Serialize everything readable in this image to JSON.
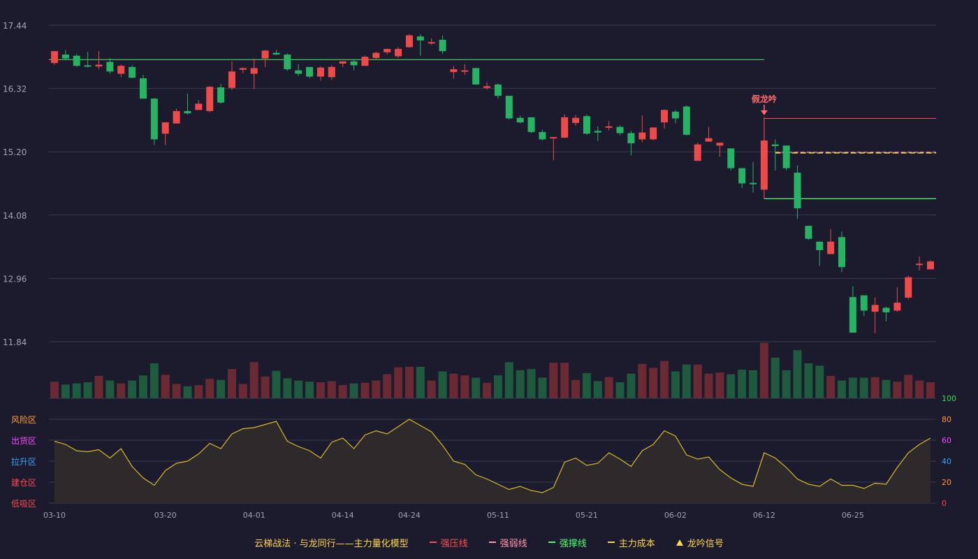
{
  "chart_data": {
    "type": "candlestick",
    "x_ticks": [
      "03-10",
      "03-20",
      "04-01",
      "04-14",
      "04-24",
      "05-11",
      "05-21",
      "06-02",
      "06-12",
      "06-25"
    ],
    "y_ticks": [
      "17.44",
      "16.32",
      "15.20",
      "14.08",
      "12.96",
      "11.84"
    ],
    "ylim": [
      11.84,
      17.44
    ],
    "candles": [
      [
        16.77,
        16.98,
        16.74,
        16.98
      ],
      [
        16.92,
        16.85,
        16.82,
        17.0
      ],
      [
        16.9,
        16.72,
        16.7,
        16.93
      ],
      [
        16.73,
        16.71,
        16.69,
        16.97
      ],
      [
        16.71,
        16.74,
        16.66,
        16.98
      ],
      [
        16.79,
        16.62,
        16.58,
        16.86
      ],
      [
        16.58,
        16.72,
        16.52,
        16.74
      ],
      [
        16.7,
        16.51,
        16.5,
        16.73
      ],
      [
        16.5,
        16.14,
        16.14,
        16.56
      ],
      [
        16.14,
        15.42,
        15.32,
        16.15
      ],
      [
        15.52,
        15.72,
        15.32,
        15.72
      ],
      [
        15.7,
        15.92,
        15.7,
        15.96
      ],
      [
        15.92,
        15.88,
        15.86,
        16.23
      ],
      [
        15.94,
        16.05,
        15.94,
        16.11
      ],
      [
        15.92,
        16.35,
        15.9,
        16.36
      ],
      [
        16.34,
        16.07,
        16.05,
        16.4
      ],
      [
        16.33,
        16.62,
        16.29,
        16.8
      ],
      [
        16.65,
        16.68,
        16.59,
        16.69
      ],
      [
        16.58,
        16.68,
        16.31,
        16.85
      ],
      [
        16.85,
        16.99,
        16.7,
        17.0
      ],
      [
        16.95,
        16.92,
        16.91,
        17.0
      ],
      [
        16.92,
        16.66,
        16.63,
        16.94
      ],
      [
        16.64,
        16.58,
        16.54,
        16.75
      ],
      [
        16.7,
        16.53,
        16.5,
        16.7
      ],
      [
        16.53,
        16.69,
        16.46,
        16.71
      ],
      [
        16.52,
        16.7,
        16.47,
        16.73
      ],
      [
        16.76,
        16.8,
        16.7,
        16.8
      ],
      [
        16.8,
        16.73,
        16.64,
        16.82
      ],
      [
        16.72,
        16.88,
        16.72,
        16.9
      ],
      [
        16.86,
        16.95,
        16.84,
        16.97
      ],
      [
        16.96,
        17.02,
        16.92,
        17.02
      ],
      [
        16.89,
        17.02,
        16.86,
        17.05
      ],
      [
        17.05,
        17.26,
        17.04,
        17.28
      ],
      [
        17.24,
        17.17,
        16.9,
        17.28
      ],
      [
        17.13,
        17.14,
        17.09,
        17.21
      ],
      [
        17.18,
        16.98,
        16.93,
        17.26
      ],
      [
        16.61,
        16.66,
        16.49,
        16.72
      ],
      [
        16.62,
        16.64,
        16.56,
        16.75
      ],
      [
        16.68,
        16.39,
        16.39,
        16.69
      ],
      [
        16.33,
        16.36,
        16.3,
        16.43
      ],
      [
        16.39,
        16.19,
        16.14,
        16.41
      ],
      [
        16.19,
        15.79,
        15.77,
        16.19
      ],
      [
        15.8,
        15.72,
        15.7,
        15.84
      ],
      [
        15.81,
        15.55,
        15.53,
        15.81
      ],
      [
        15.55,
        15.42,
        15.4,
        15.59
      ],
      [
        15.44,
        15.46,
        15.05,
        15.46
      ],
      [
        15.45,
        15.81,
        15.44,
        15.86
      ],
      [
        15.71,
        15.8,
        15.66,
        15.85
      ],
      [
        15.83,
        15.52,
        15.5,
        15.86
      ],
      [
        15.57,
        15.54,
        15.39,
        15.65
      ],
      [
        15.63,
        15.65,
        15.58,
        15.74
      ],
      [
        15.64,
        15.53,
        15.49,
        15.67
      ],
      [
        15.53,
        15.35,
        15.14,
        15.57
      ],
      [
        15.42,
        15.54,
        15.37,
        15.84
      ],
      [
        15.42,
        15.63,
        15.4,
        15.63
      ],
      [
        15.72,
        15.94,
        15.61,
        15.95
      ],
      [
        15.91,
        15.79,
        15.7,
        15.94
      ],
      [
        16.0,
        15.5,
        15.49,
        16.02
      ],
      [
        15.04,
        15.33,
        15.04,
        15.36
      ],
      [
        15.38,
        15.44,
        15.38,
        15.64
      ],
      [
        15.31,
        15.36,
        15.11,
        15.36
      ],
      [
        15.26,
        14.91,
        14.87,
        15.26
      ],
      [
        14.91,
        14.64,
        14.56,
        14.91
      ],
      [
        14.65,
        14.64,
        14.48,
        15.02
      ],
      [
        14.53,
        15.4,
        14.53,
        15.81
      ],
      [
        15.33,
        15.3,
        14.87,
        15.42
      ],
      [
        15.31,
        14.91,
        14.87,
        15.29
      ],
      [
        14.83,
        14.2,
        14.01,
        14.96
      ],
      [
        13.89,
        13.66,
        13.64,
        13.89
      ],
      [
        13.61,
        13.46,
        13.18,
        13.61
      ],
      [
        13.39,
        13.61,
        13.39,
        13.83
      ],
      [
        13.69,
        13.16,
        13.07,
        13.79
      ],
      [
        12.63,
        12.0,
        12.0,
        12.82
      ],
      [
        12.66,
        12.39,
        12.29,
        12.66
      ],
      [
        12.37,
        12.49,
        11.99,
        12.62
      ],
      [
        12.44,
        12.36,
        12.2,
        12.46
      ],
      [
        12.39,
        12.53,
        12.37,
        12.8
      ],
      [
        12.62,
        12.98,
        12.59,
        13.01
      ],
      [
        13.22,
        13.22,
        13.1,
        13.35
      ],
      [
        13.12,
        13.26,
        13.12,
        13.28
      ]
    ],
    "volumes": [
      0.29,
      0.24,
      0.26,
      0.28,
      0.39,
      0.31,
      0.26,
      0.31,
      0.4,
      0.61,
      0.41,
      0.25,
      0.21,
      0.23,
      0.34,
      0.32,
      0.51,
      0.25,
      0.63,
      0.38,
      0.48,
      0.35,
      0.31,
      0.29,
      0.28,
      0.3,
      0.23,
      0.26,
      0.27,
      0.31,
      0.42,
      0.54,
      0.55,
      0.55,
      0.31,
      0.47,
      0.43,
      0.4,
      0.36,
      0.27,
      0.4,
      0.63,
      0.49,
      0.51,
      0.36,
      0.62,
      0.62,
      0.32,
      0.44,
      0.3,
      0.37,
      0.28,
      0.43,
      0.6,
      0.53,
      0.65,
      0.47,
      0.59,
      0.59,
      0.43,
      0.45,
      0.42,
      0.5,
      0.49,
      0.97,
      0.71,
      0.49,
      0.84,
      0.61,
      0.57,
      0.39,
      0.31,
      0.36,
      0.36,
      0.37,
      0.32,
      0.29,
      0.41,
      0.31,
      0.28
    ],
    "oscillator": {
      "left_labels": [
        {
          "text": "风险区",
          "color": "#ff9f33"
        },
        {
          "text": "出货区",
          "color": "#ff44ff"
        },
        {
          "text": "拉升区",
          "color": "#3da5ff"
        },
        {
          "text": "建仓区",
          "color": "#ff4455"
        },
        {
          "text": "低吸区",
          "color": "#ff4455"
        }
      ],
      "right_ticks": [
        {
          "text": "100",
          "color": "#33dd55"
        },
        {
          "text": "80",
          "color": "#ff9f33"
        },
        {
          "text": "60",
          "color": "#ff44ff"
        },
        {
          "text": "40",
          "color": "#3da5ff"
        },
        {
          "text": "20",
          "color": "#ff9f33"
        },
        {
          "text": "0",
          "color": "#ff4455"
        }
      ],
      "values": [
        59,
        56,
        50,
        49,
        51,
        43,
        52,
        35,
        24,
        17,
        31,
        38,
        40,
        47,
        57,
        52,
        66,
        71,
        72,
        75,
        78,
        59,
        54,
        50,
        43,
        58,
        62,
        52,
        65,
        69,
        66,
        73,
        80,
        74,
        68,
        55,
        40,
        37,
        27,
        23,
        18,
        13,
        16,
        12,
        10,
        15,
        39,
        43,
        36,
        38,
        48,
        42,
        35,
        50,
        56,
        69,
        64,
        46,
        42,
        44,
        32,
        24,
        18,
        16,
        48,
        43,
        34,
        23,
        18,
        16,
        23,
        17,
        17,
        14,
        19,
        18,
        34,
        48,
        56,
        62
      ]
    },
    "annotations": {
      "signal_label": "假龙吟",
      "signal_index": 64,
      "resist_start_index": 64,
      "resist_value": 15.79,
      "weak_start_index": 65,
      "weak_value": 15.19,
      "cost_start_index": 65,
      "cost_value": 15.18,
      "support_start_index": 64,
      "support_value": 14.37,
      "long_support_end_index": 64,
      "long_support_value": 16.83
    },
    "legend": [
      {
        "label": "云梯战法 · 与龙同行——主力量化模型",
        "color": "#ffd54a",
        "kind": "text"
      },
      {
        "label": "强压线",
        "color": "#ff4f4f",
        "kind": "line"
      },
      {
        "label": "强弱线",
        "color": "#ff9aa8",
        "kind": "dashed"
      },
      {
        "label": "强撑线",
        "color": "#4dff6e",
        "kind": "line"
      },
      {
        "label": "主力成本",
        "color": "#ffd54a",
        "kind": "dashed"
      },
      {
        "label": "龙吟信号",
        "color": "#ffd54a",
        "kind": "triangle"
      }
    ],
    "colors": {
      "up": "#ef4a4a",
      "down": "#26b364",
      "grid": "#3b3b52",
      "axis_text": "#a0a3b3",
      "oscillator_line": "#d8b92b"
    }
  }
}
